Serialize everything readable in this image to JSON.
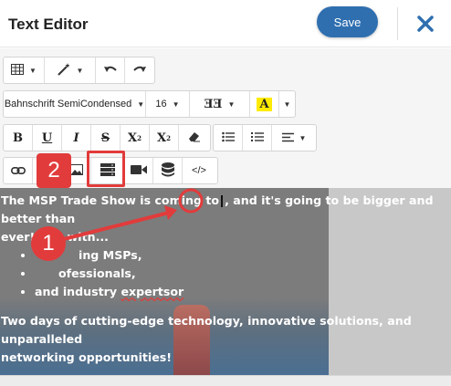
{
  "header": {
    "title": "Text Editor",
    "save_label": "Save",
    "close_icon": "close-icon"
  },
  "toolbar": {
    "font_family": "Bahnschrift SemiCondensed",
    "font_size": "16",
    "bold_label": "B",
    "underline_label": "U",
    "italic_label": "I",
    "strike_label": "S",
    "superscript_label": "X",
    "superscript_mark": "2",
    "subscript_label": "X",
    "subscript_mark": "2",
    "code_label": "</>",
    "highlight_label": "A",
    "font_color_label": "A"
  },
  "annotations": {
    "step1": "1",
    "step2": "2",
    "accent_color": "#e23b3b"
  },
  "editor": {
    "paragraph1": "The MSP Trade Show is coming to , and it's going to be bigger and better than ever! Join with...",
    "line1a": "The MSP Trade Show is coming to",
    "line1b": ", and it's going to be bigger and better than",
    "line2": "ever! Join with...",
    "bullets": [
      "ing MSPs,",
      "ofessionals,",
      "and industry "
    ],
    "bullet3_misspelled": "expertsor",
    "paragraph2_line1": "Two days of cutting-edge technology, innovative solutions, and unparalleled",
    "paragraph2_line2": "networking opportunities!"
  },
  "colors": {
    "save_button": "#2f6fb0",
    "close_icon": "#2f6fb0",
    "highlight_yellow": "#ffeb00"
  }
}
